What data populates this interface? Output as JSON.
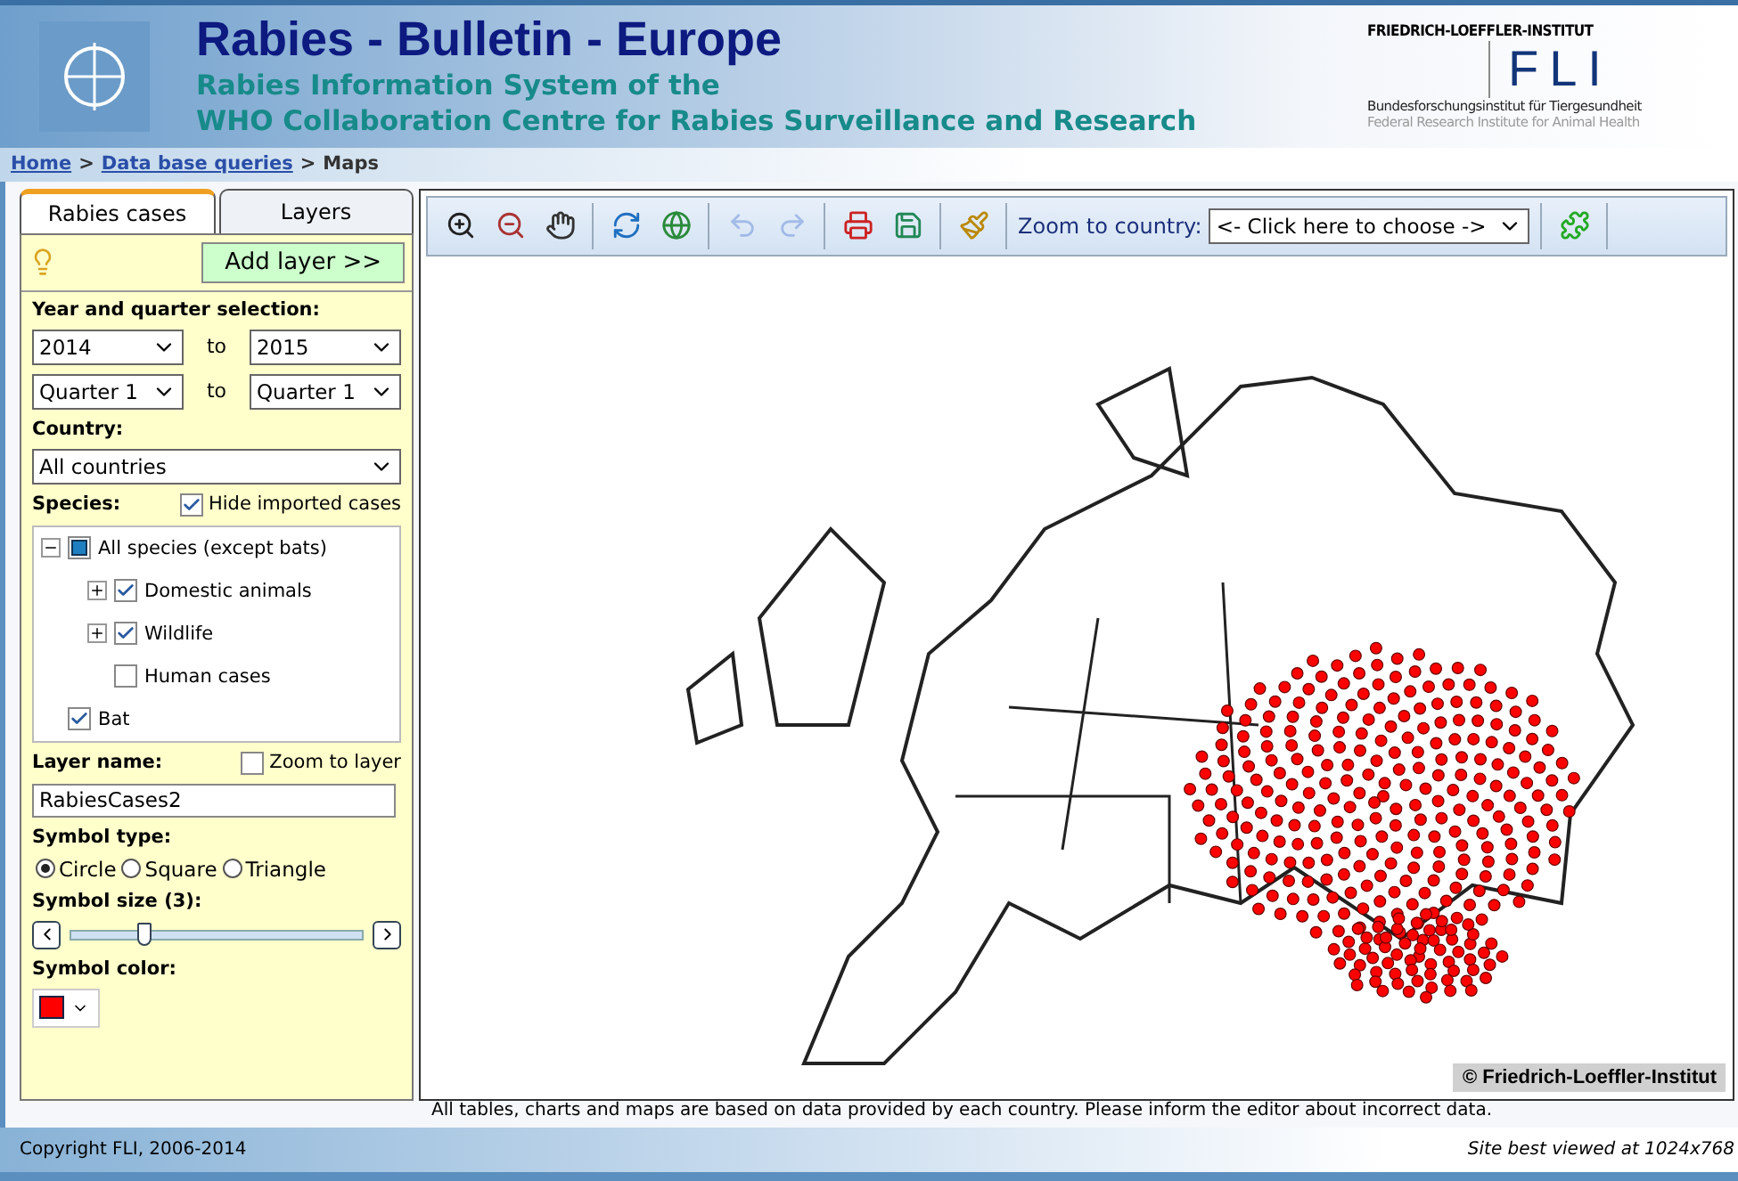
{
  "header": {
    "title": "Rabies - Bulletin - Europe",
    "subtitle_lines": [
      "Rabies Information System of the",
      "WHO Collaboration Centre for Rabies Surveillance and Research"
    ],
    "partner": {
      "name": "FRIEDRICH-LOEFFLER-INSTITUT",
      "abbr": "FLI",
      "german": "Bundesforschungsinstitut für Tiergesundheit",
      "english": "Federal Research Institute for Animal Health"
    }
  },
  "breadcrumb": [
    {
      "label": "Home",
      "link": true
    },
    {
      "label": ">",
      "link": false
    },
    {
      "label": "Data base queries",
      "link": true
    },
    {
      "label": ">",
      "link": false
    },
    {
      "label": "Maps",
      "link": false
    }
  ],
  "tabs": [
    {
      "label": "Rabies cases",
      "selected": true
    },
    {
      "label": "Layers",
      "selected": false
    }
  ],
  "add_layer_button": "Add layer >>",
  "year_quarter": {
    "label": "Year and quarter selection:",
    "from_year": "2014",
    "to_year": "2015",
    "from_quarter": "Quarter 1",
    "to_quarter": "Quarter 1",
    "to_words": [
      "to",
      "to"
    ]
  },
  "country": {
    "label": "Country:",
    "value": "All countries"
  },
  "species": {
    "label": "Species:",
    "hide_imported": {
      "label": "Hide imported cases",
      "checked": true
    },
    "tree": [
      {
        "label": "All species (except bats)",
        "partial": true,
        "expanded": true,
        "children": [
          {
            "label": "Domestic animals",
            "checked": true,
            "expanded": false
          },
          {
            "label": "Wildlife",
            "checked": true,
            "expanded": false
          },
          {
            "label": "Human cases",
            "checked": false
          }
        ]
      },
      {
        "label": "Bat",
        "checked": true
      }
    ]
  },
  "layer": {
    "label": "Layer name:",
    "value": "RabiesCases2",
    "zoom_to_layer": {
      "label": "Zoom to layer",
      "checked": false
    }
  },
  "symbol_type": {
    "label": "Symbol type:",
    "options": [
      {
        "label": "Circle",
        "selected": true
      },
      {
        "label": "Square",
        "selected": false
      },
      {
        "label": "Triangle",
        "selected": false
      }
    ]
  },
  "symbol_size": {
    "label": "Symbol size (3):",
    "level": 0.25
  },
  "symbol_color": {
    "label": "Symbol color:",
    "color": "#ff0000"
  },
  "toolbar": {
    "tools": [
      {
        "kind": "zoom-in",
        "disabled": false
      },
      {
        "kind": "zoom-out",
        "disabled": false
      },
      {
        "kind": "pan",
        "disabled": false
      },
      {
        "kind": "sep"
      },
      {
        "kind": "refresh",
        "disabled": false
      },
      {
        "kind": "globe",
        "disabled": false
      },
      {
        "kind": "sep"
      },
      {
        "kind": "undo",
        "disabled": true
      },
      {
        "kind": "redo",
        "disabled": true
      },
      {
        "kind": "sep"
      },
      {
        "kind": "print",
        "disabled": false
      },
      {
        "kind": "save",
        "disabled": false
      },
      {
        "kind": "sep"
      },
      {
        "kind": "clear",
        "disabled": false
      },
      {
        "kind": "sep"
      }
    ],
    "zoom_label": "Zoom to country:",
    "zoom_value": "<- Click here to choose ->",
    "extra_tool": {
      "kind": "add-layer",
      "disabled": false
    }
  },
  "map": {
    "credit": "© Friedrich-Loeffler-Institut"
  },
  "note": "All tables, charts and maps are based on data provided by each country. Please inform the editor about incorrect data.",
  "footer": {
    "copyright": "Copyright FLI, 2006-2014",
    "hint": "Site best viewed at 1024x768"
  }
}
